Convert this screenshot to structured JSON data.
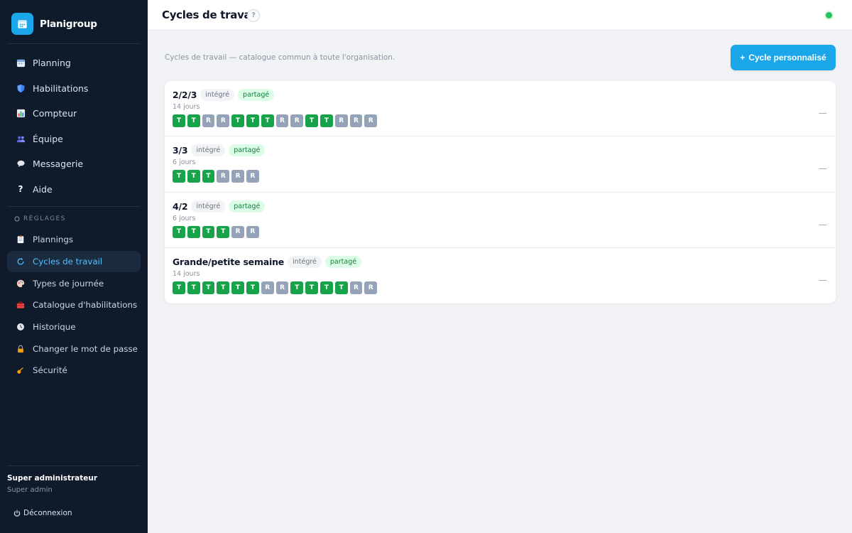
{
  "app": {
    "name": "Planigroup"
  },
  "colors": {
    "accent": "#1aa6e8",
    "sidebar_bg": "#0f1a2a",
    "work_day": "#16a34a",
    "rest_day": "#94a3b8",
    "status_online": "#22c55e"
  },
  "sidebar": {
    "main_items": [
      {
        "label": "Planning",
        "icon": "calendar-icon"
      },
      {
        "label": "Habilitations",
        "icon": "shield-icon"
      },
      {
        "label": "Compteur",
        "icon": "bar-chart-icon"
      },
      {
        "label": "Équipe",
        "icon": "team-icon"
      },
      {
        "label": "Messagerie",
        "icon": "chat-bubble-icon"
      },
      {
        "label": "Aide",
        "icon": "question-icon"
      }
    ],
    "settings_title": "RÉGLAGES",
    "settings_items": [
      {
        "label": "Plannings",
        "icon": "clipboard-icon"
      },
      {
        "label": "Cycles de travail",
        "icon": "cycle-icon",
        "active": true
      },
      {
        "label": "Types de journée",
        "icon": "palette-icon"
      },
      {
        "label": "Catalogue d'habilitations",
        "icon": "toolbox-icon"
      },
      {
        "label": "Historique",
        "icon": "clock-icon"
      },
      {
        "label": "Changer le mot de passe",
        "icon": "lock-icon"
      },
      {
        "label": "Sécurité",
        "icon": "key-icon"
      }
    ],
    "user": {
      "name": "Super administrateur",
      "role": "Super admin"
    },
    "logout_label": "Déconnexion"
  },
  "header": {
    "title": "Cycles de travail",
    "help_label": "?"
  },
  "main": {
    "subtitle": "Cycles de travail — catalogue commun à toute l'organisation.",
    "add_button_label": "Cycle personnalisé",
    "add_button_icon": "+",
    "row_menu_label": "—",
    "cycles": [
      {
        "name": "2/2/3",
        "tag_builtin": "intégré",
        "tag_shared": "partagé",
        "days_label": "14 jours",
        "sequence": [
          "T",
          "T",
          "R",
          "R",
          "T",
          "T",
          "T",
          "R",
          "R",
          "T",
          "T",
          "R",
          "R",
          "R"
        ]
      },
      {
        "name": "3/3",
        "tag_builtin": "intégré",
        "tag_shared": "partagé",
        "days_label": "6 jours",
        "sequence": [
          "T",
          "T",
          "T",
          "R",
          "R",
          "R"
        ]
      },
      {
        "name": "4/2",
        "tag_builtin": "intégré",
        "tag_shared": "partagé",
        "days_label": "6 jours",
        "sequence": [
          "T",
          "T",
          "T",
          "T",
          "R",
          "R"
        ]
      },
      {
        "name": "Grande/petite semaine",
        "tag_builtin": "intégré",
        "tag_shared": "partagé",
        "days_label": "14 jours",
        "sequence": [
          "T",
          "T",
          "T",
          "T",
          "T",
          "T",
          "R",
          "R",
          "T",
          "T",
          "T",
          "T",
          "R",
          "R"
        ]
      }
    ]
  }
}
